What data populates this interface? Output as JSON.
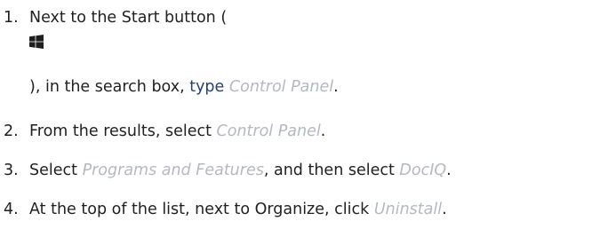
{
  "steps": [
    {
      "number": "1.",
      "line1": "Next to the Start button (",
      "icon": "windows-logo-icon",
      "line2_prefix": "), in the search box, ",
      "type_word": "type",
      "line2_gap": " ",
      "term": "Control Panel",
      "line2_suffix": "."
    },
    {
      "number": "2.",
      "prefix": "From the results, select ",
      "term": "Control Panel",
      "suffix": "."
    },
    {
      "number": "3.",
      "prefix": "Select ",
      "term1": "Programs and Features",
      "middle": ", and then select ",
      "term2": "DocIQ",
      "suffix": "."
    },
    {
      "number": "4.",
      "prefix": "At the top of the list, next to Organize, click ",
      "term": "Uninstall",
      "suffix": "."
    }
  ],
  "colors": {
    "text": "#1f1f1f",
    "ui_term": "#b3b8c2",
    "type_word": "#29406b"
  }
}
